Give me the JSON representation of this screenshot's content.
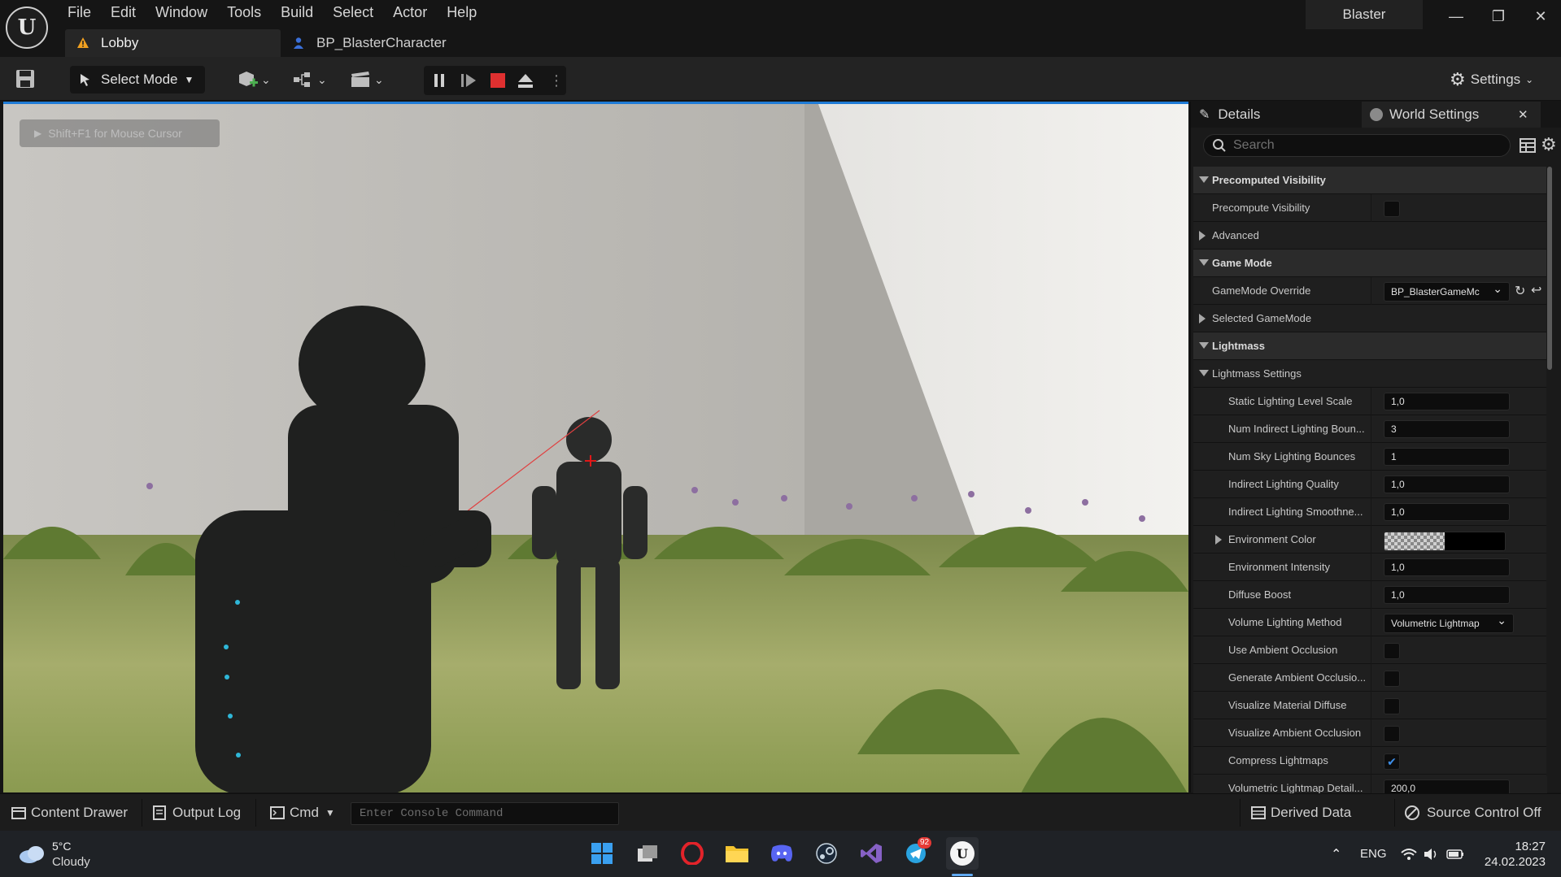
{
  "menu": [
    "File",
    "Edit",
    "Window",
    "Tools",
    "Build",
    "Select",
    "Actor",
    "Help"
  ],
  "tabs": [
    {
      "label": "Lobby",
      "icon": "level-warning-icon",
      "active": true
    },
    {
      "label": "BP_BlasterCharacter",
      "icon": "character-blueprint-icon",
      "active": false
    }
  ],
  "project_name": "Blaster",
  "toolbar": {
    "mode_label": "Select Mode",
    "settings_label": "Settings"
  },
  "viewport": {
    "mouse_hint": "Shift+F1 for Mouse Cursor"
  },
  "details": {
    "tab_details": "Details",
    "tab_world_settings": "World Settings",
    "search_placeholder": "Search",
    "rows": [
      {
        "type": "cat",
        "label": "Precomputed Visibility",
        "expanded": true
      },
      {
        "type": "prop",
        "label": "Precompute Visibility",
        "control": "checkbox",
        "checked": false
      },
      {
        "type": "group",
        "label": "Advanced",
        "expanded": false
      },
      {
        "type": "cat",
        "label": "Game Mode",
        "expanded": true
      },
      {
        "type": "prop",
        "label": "GameMode Override",
        "control": "dropdown",
        "value": "BP_BlasterGameMc"
      },
      {
        "type": "group",
        "label": "Selected GameMode",
        "expanded": false
      },
      {
        "type": "cat",
        "label": "Lightmass",
        "expanded": true
      },
      {
        "type": "group",
        "label": "Lightmass Settings",
        "expanded": true
      },
      {
        "type": "sub",
        "label": "Static Lighting Level Scale",
        "control": "number",
        "value": "1,0"
      },
      {
        "type": "sub",
        "label": "Num Indirect Lighting Boun...",
        "control": "number",
        "value": "3"
      },
      {
        "type": "sub",
        "label": "Num Sky Lighting Bounces",
        "control": "number",
        "value": "1"
      },
      {
        "type": "sub",
        "label": "Indirect Lighting Quality",
        "control": "number",
        "value": "1,0"
      },
      {
        "type": "sub",
        "label": "Indirect Lighting Smoothne...",
        "control": "number",
        "value": "1,0"
      },
      {
        "type": "subgroup",
        "label": "Environment Color",
        "control": "color"
      },
      {
        "type": "sub",
        "label": "Environment Intensity",
        "control": "number",
        "value": "1,0"
      },
      {
        "type": "sub",
        "label": "Diffuse Boost",
        "control": "number",
        "value": "1,0"
      },
      {
        "type": "sub",
        "label": "Volume Lighting Method",
        "control": "dropdown",
        "value": "Volumetric Lightmap"
      },
      {
        "type": "sub",
        "label": "Use Ambient Occlusion",
        "control": "checkbox",
        "checked": false
      },
      {
        "type": "sub",
        "label": "Generate Ambient Occlusio...",
        "control": "checkbox",
        "checked": false
      },
      {
        "type": "sub",
        "label": "Visualize Material Diffuse",
        "control": "checkbox",
        "checked": false
      },
      {
        "type": "sub",
        "label": "Visualize Ambient Occlusion",
        "control": "checkbox",
        "checked": false
      },
      {
        "type": "sub",
        "label": "Compress Lightmaps",
        "control": "checkbox",
        "checked": true
      },
      {
        "type": "sub",
        "label": "Volumetric Lightmap Detail...",
        "control": "number",
        "value": "200,0"
      }
    ]
  },
  "statusbar": {
    "content_drawer": "Content Drawer",
    "output_log": "Output Log",
    "cmd": "Cmd",
    "console_placeholder": "Enter Console Command",
    "derived_data": "Derived Data",
    "source_control": "Source Control Off"
  },
  "taskbar": {
    "temperature": "5°C",
    "weather": "Cloudy",
    "language": "ENG",
    "time": "18:27",
    "date": "24.02.2023",
    "telegram_badge": "92",
    "apps": [
      "windows-start-icon",
      "task-view-icon",
      "opera-icon",
      "file-explorer-icon",
      "discord-icon",
      "steam-icon",
      "visual-studio-icon",
      "telegram-icon",
      "unreal-engine-icon"
    ]
  },
  "colors": {
    "accent_blue": "#1f7bd6",
    "stop_red": "#e03030",
    "check_blue": "#3d8ee8"
  }
}
